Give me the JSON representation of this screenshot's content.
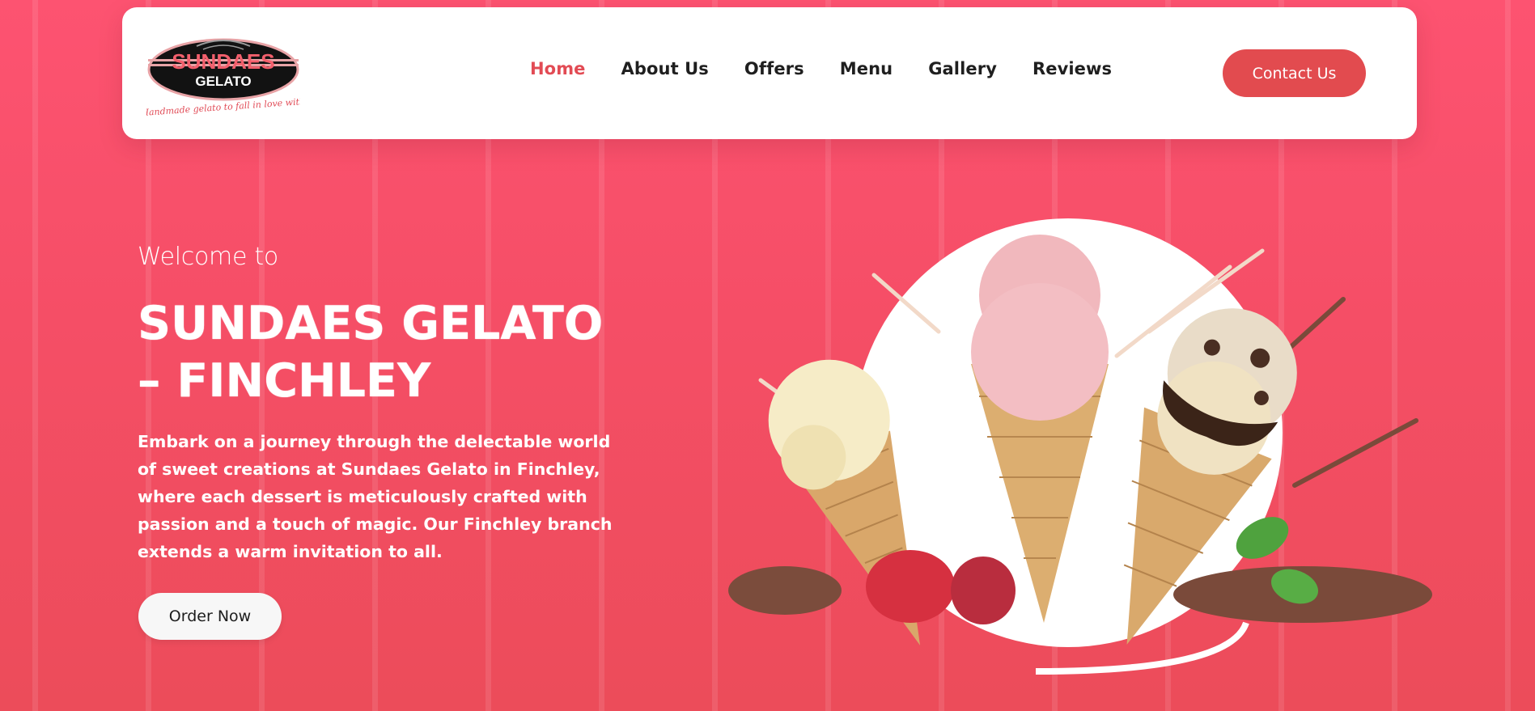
{
  "brand": {
    "logo_name": "SUNDAES",
    "logo_sub": "GELATO",
    "logo_tagline": "Handmade gelato to fall in love with"
  },
  "nav": {
    "items": [
      {
        "label": "Home",
        "active": true
      },
      {
        "label": "About Us",
        "active": false
      },
      {
        "label": "Offers",
        "active": false
      },
      {
        "label": "Menu",
        "active": false
      },
      {
        "label": "Gallery",
        "active": false
      },
      {
        "label": "Reviews",
        "active": false
      }
    ],
    "contact_label": "Contact Us"
  },
  "hero": {
    "welcome": "Welcome to",
    "title": "SUNDAES GELATO – FINCHLEY",
    "description": "Embark on a journey through the delectable world of sweet creations at Sundaes Gelato in Finchley, where each dessert is meticulously crafted with passion and a touch of magic. Our Finchley branch extends a warm invitation to all.",
    "order_label": "Order Now"
  },
  "colors": {
    "background": "#f54e66",
    "accent": "#e24b4f",
    "active_nav": "#e24b54",
    "text_dark": "#1f1f1f"
  }
}
